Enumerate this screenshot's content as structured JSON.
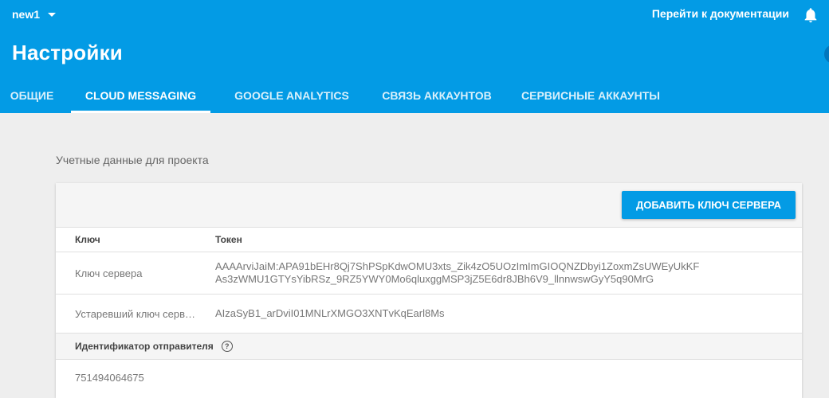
{
  "header": {
    "project_name": "new1",
    "docs_link": "Перейти к документации",
    "title": "Настройки",
    "tabs": [
      {
        "label": "ОБЩИЕ",
        "active": false
      },
      {
        "label": "CLOUD MESSAGING",
        "active": true
      },
      {
        "label": "GOOGLE ANALYTICS",
        "active": false
      },
      {
        "label": "СВЯЗЬ АККАУНТОВ",
        "active": false
      },
      {
        "label": "СЕРВИСНЫЕ АККАУНТЫ",
        "active": false
      }
    ],
    "icons": {
      "project_dropdown": "chevron-down-icon",
      "notifications": "bell-icon"
    }
  },
  "credentials": {
    "section_label": "Учетные данные для проекта",
    "add_key_button": "ДОБАВИТЬ КЛЮЧ СЕРВЕРА",
    "columns": {
      "key": "Ключ",
      "token": "Токен"
    },
    "rows": [
      {
        "key": "Ключ сервера",
        "token_line1": "AAAArviJaiM:APA91bEHr8Qj7ShPSpKdwOMU3xts_Zik4zO5UOzImImGIOQNZDbyi1ZoxmZsUWEyUkKF",
        "token_line2": "As3zWMU1GTYsYibRSz_9RZ5YWY0Mo6qluxggMSP3jZ5E6dr8JBh6V9_llnnwswGyY5q90MrG"
      },
      {
        "key": "Устаревший ключ серв…",
        "token": "AIzaSyB1_arDviI01MNLrXMGO3XNTvKqEarl8Ms"
      }
    ],
    "sender_id_label": "Идентификатор отправителя",
    "sender_id_help": "?",
    "sender_id_value": "751494064675"
  },
  "colors": {
    "accent": "#039be5",
    "background": "#eeeeee"
  }
}
